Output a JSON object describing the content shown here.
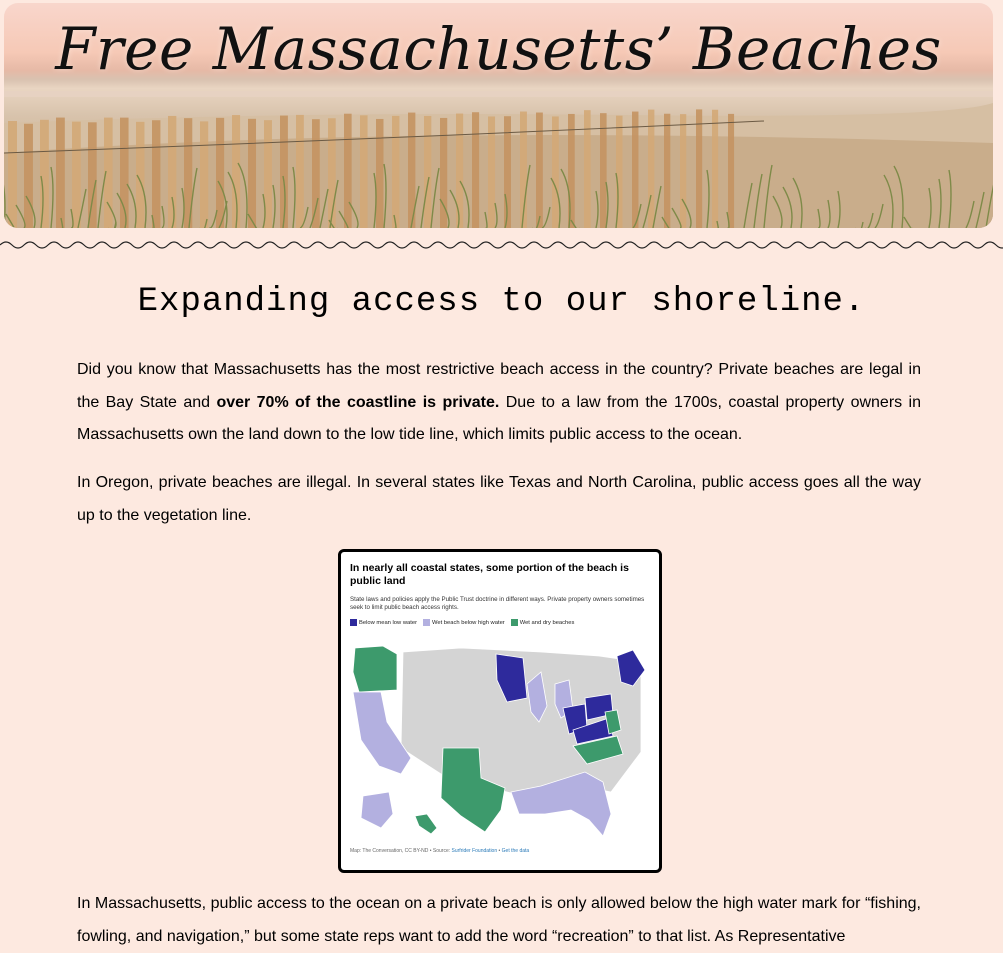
{
  "site": {
    "title": "Free Massachusetts’ Beaches"
  },
  "section": {
    "heading": "Expanding access to our shoreline."
  },
  "paragraphs": {
    "p1_a": "Did you know that Massachusetts has the most restrictive beach access in the country? Private beaches are legal in the Bay State and ",
    "p1_bold": "over 70% of the coastline is private.",
    "p1_b": " Due to a law from the 1700s, coastal property owners in Massachusetts own the land down to the low tide line, which limits public access to the ocean.",
    "p2": "In Oregon, private beaches are illegal. In several states like Texas and North Carolina, public access goes all the way up to the vegetation line.",
    "p3": "In Massachusetts, public access to the ocean on a private beach is only allowed below the high water mark for “fishing, fowling, and navigation,” but some state reps want to add the word “recreation” to that list. As Representative"
  },
  "map": {
    "title": "In nearly all coastal states, some portion of the beach is public land",
    "subtitle": "State laws and policies apply the Public Trust doctrine in different ways. Private property owners sometimes seek to limit public beach access rights.",
    "legend": [
      {
        "label": "Below mean low water",
        "color": "#2e2a9c"
      },
      {
        "label": "Wet beach below high water",
        "color": "#b3b0e0"
      },
      {
        "label": "Wet and dry beaches",
        "color": "#3d9a6c"
      }
    ],
    "source_prefix": "Map: The Conversation, CC BY-ND • Source: ",
    "source_link": "Surfrider Foundation",
    "source_sep": " • ",
    "data_link": "Get the data",
    "colors": {
      "other": "#d4d4d4",
      "low": "#2e2a9c",
      "wet": "#b3b0e0",
      "dry": "#3d9a6c"
    }
  }
}
